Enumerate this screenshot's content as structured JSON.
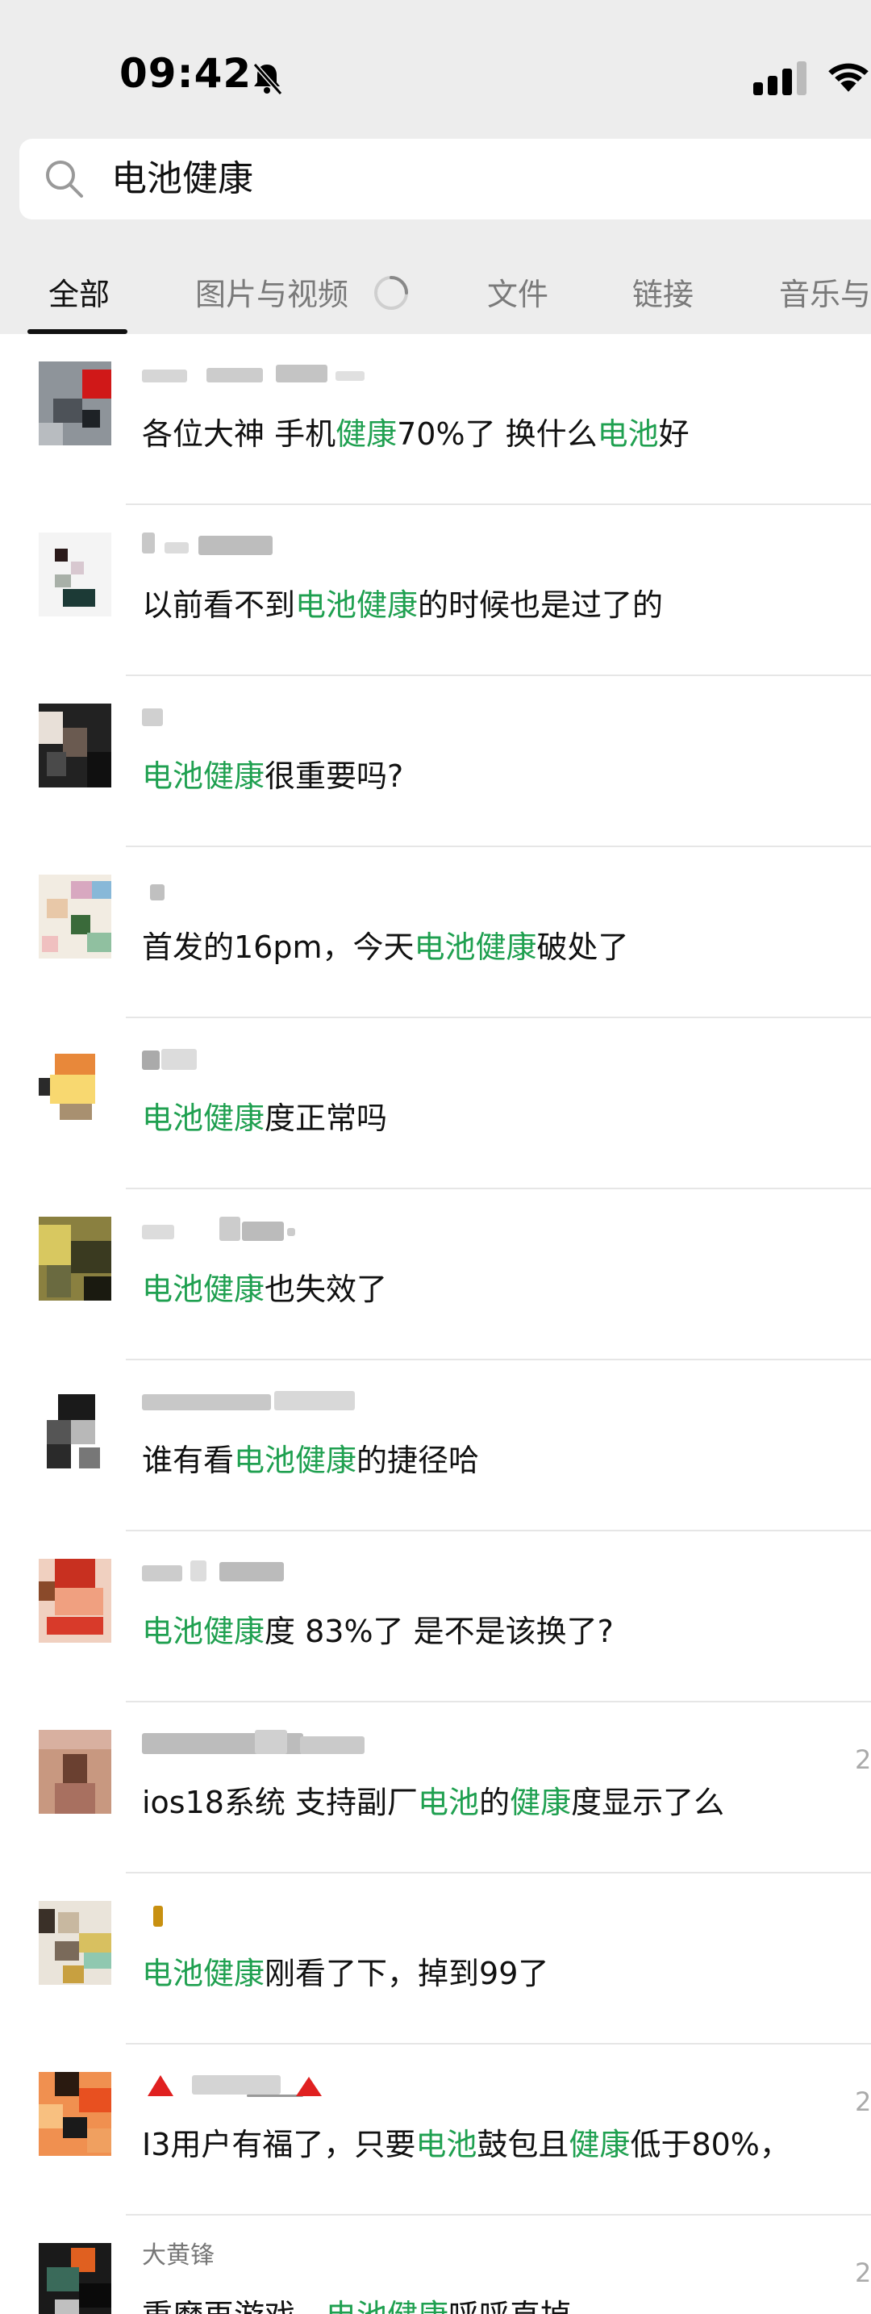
{
  "status": {
    "time": "09:42"
  },
  "search": {
    "query": "电池健康"
  },
  "tabs": [
    {
      "label": "全部",
      "active": true
    },
    {
      "label": "图片与视频",
      "active": false
    },
    {
      "label": "文件",
      "active": false
    },
    {
      "label": "链接",
      "active": false
    },
    {
      "label": "音乐与",
      "active": false
    }
  ],
  "colors": {
    "highlight": "#1fa050",
    "header_bg": "#ededed"
  },
  "results": [
    {
      "message": [
        {
          "t": "各位大神 手机"
        },
        {
          "t": "健康",
          "h": true
        },
        {
          "t": "70%了 换什么"
        },
        {
          "t": "电池",
          "h": true
        },
        {
          "t": "好"
        }
      ]
    },
    {
      "message": [
        {
          "t": "以前看不到"
        },
        {
          "t": "电池健康",
          "h": true
        },
        {
          "t": "的时候也是过了的"
        }
      ]
    },
    {
      "message": [
        {
          "t": "电池健康",
          "h": true
        },
        {
          "t": "很重要吗?"
        }
      ]
    },
    {
      "message": [
        {
          "t": "首发的16pm，今天"
        },
        {
          "t": "电池健康",
          "h": true
        },
        {
          "t": "破处了"
        }
      ]
    },
    {
      "message": [
        {
          "t": "电池健康",
          "h": true
        },
        {
          "t": "度正常吗"
        }
      ]
    },
    {
      "message": [
        {
          "t": "电池健康",
          "h": true
        },
        {
          "t": "也失效了"
        }
      ]
    },
    {
      "message": [
        {
          "t": "谁有看"
        },
        {
          "t": "电池健康",
          "h": true
        },
        {
          "t": "的捷径哈"
        }
      ]
    },
    {
      "message": [
        {
          "t": "电池健康",
          "h": true
        },
        {
          "t": "度 83%了  是不是该换了?"
        }
      ]
    },
    {
      "message": [
        {
          "t": "ios18系统 支持副厂"
        },
        {
          "t": "电池",
          "h": true
        },
        {
          "t": "的"
        },
        {
          "t": "健康",
          "h": true
        },
        {
          "t": "度显示了么"
        }
      ],
      "date": "2"
    },
    {
      "message": [
        {
          "t": "电池健康",
          "h": true
        },
        {
          "t": "刚看了下，掉到99了"
        }
      ]
    },
    {
      "message": [
        {
          "t": "I3用户有福了，只要"
        },
        {
          "t": "电池",
          "h": true
        },
        {
          "t": "鼓包且"
        },
        {
          "t": "健康",
          "h": true
        },
        {
          "t": "低于80%，"
        }
      ],
      "date": "2"
    },
    {
      "name": "大黄锋",
      "message": [
        {
          "t": "重磨再游戏，"
        },
        {
          "t": "电池健康",
          "h": true
        },
        {
          "t": "呼呼直掉"
        }
      ],
      "date": "2"
    }
  ]
}
